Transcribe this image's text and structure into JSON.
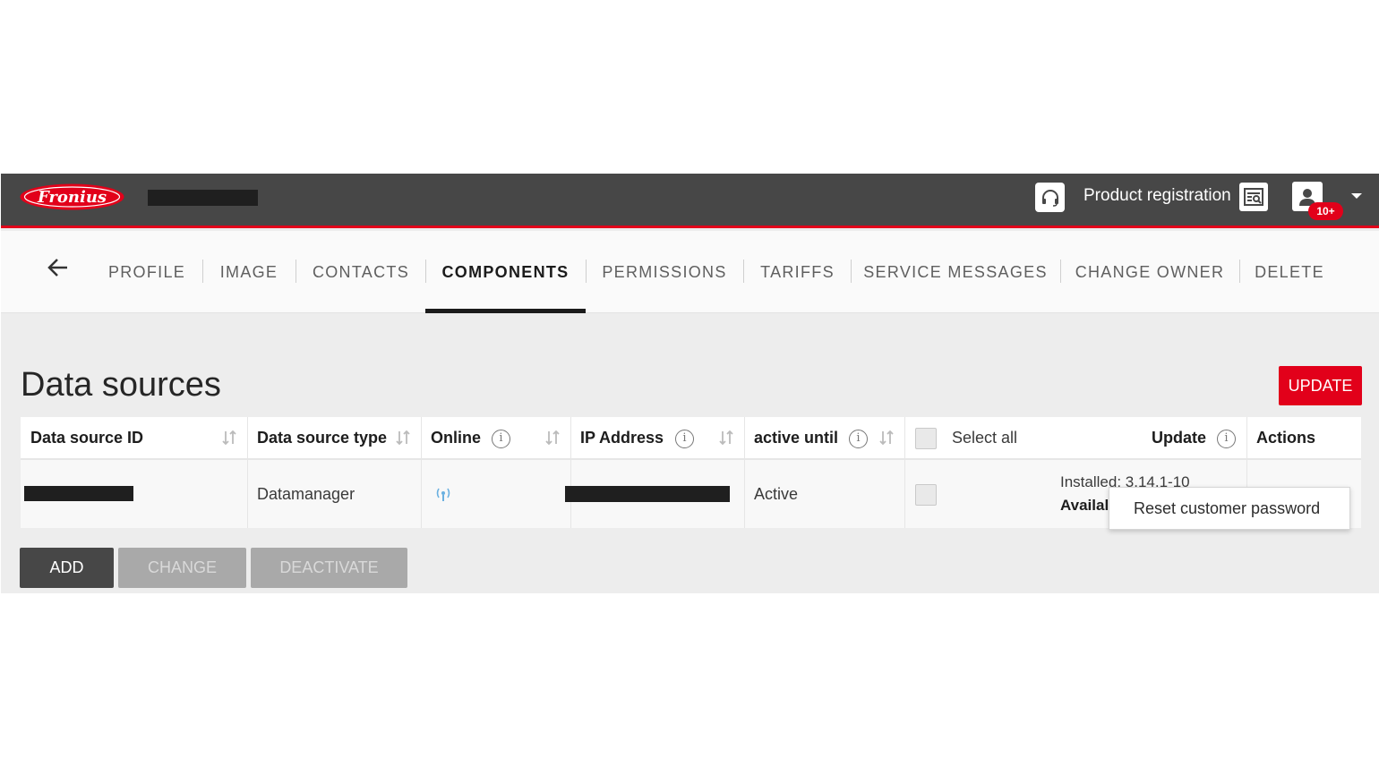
{
  "brand": {
    "logo_text": "Fronius",
    "accent": "#e2001a"
  },
  "header": {
    "product_registration": "Product registration",
    "notification_badge": "10+"
  },
  "tabs": [
    {
      "label": "PROFILE"
    },
    {
      "label": "IMAGE"
    },
    {
      "label": "CONTACTS"
    },
    {
      "label": "COMPONENTS",
      "active": true
    },
    {
      "label": "PERMISSIONS"
    },
    {
      "label": "TARIFFS"
    },
    {
      "label": "SERVICE MESSAGES"
    },
    {
      "label": "CHANGE OWNER"
    },
    {
      "label": "DELETE"
    }
  ],
  "page": {
    "title": "Data sources",
    "update_label": "UPDATE"
  },
  "table": {
    "headers": {
      "id": "Data source ID",
      "type": "Data source type",
      "online": "Online",
      "ip": "IP Address",
      "active_until": "active until",
      "select_all": "Select all",
      "update": "Update",
      "actions": "Actions"
    },
    "rows": [
      {
        "type": "Datamanager",
        "active_until": "Active",
        "installed": "Installed: 3.14.1-10",
        "available": "Availal"
      }
    ]
  },
  "popup": {
    "label": "Reset customer password"
  },
  "buttons": {
    "add": "ADD",
    "change": "CHANGE",
    "deactivate": "DEACTIVATE"
  },
  "icons": [
    "headset-icon",
    "product-registration-icon",
    "user-icon",
    "back-arrow-icon",
    "sort-icon",
    "info-icon",
    "wifi-icon"
  ]
}
